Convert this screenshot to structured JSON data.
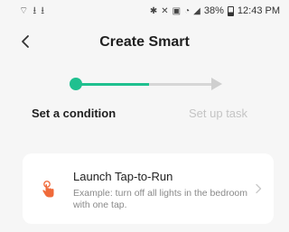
{
  "status_bar": {
    "left_icons": [
      "wifi-signal-icon",
      "download-icon",
      "download-icon"
    ],
    "right_icons": [
      "bluetooth-icon",
      "mute-icon",
      "nfc-icon",
      "wifi-icon",
      "cell-signal-icon"
    ],
    "battery_percent": "38%",
    "time": "12:43 PM"
  },
  "header": {
    "title": "Create Smart",
    "back_icon": "chevron-left-icon"
  },
  "stepper": {
    "active_color": "#1fc08f",
    "pending_color": "#d6d6d6",
    "steps": [
      {
        "label": "Set a condition",
        "state": "active"
      },
      {
        "label": "Set up task",
        "state": "pending"
      }
    ]
  },
  "options": [
    {
      "title": "Launch Tap-to-Run",
      "description": "Example: turn off all lights in the bedroom with one tap.",
      "icon": "tap-finger-icon",
      "icon_color": "#f06a3a"
    }
  ]
}
